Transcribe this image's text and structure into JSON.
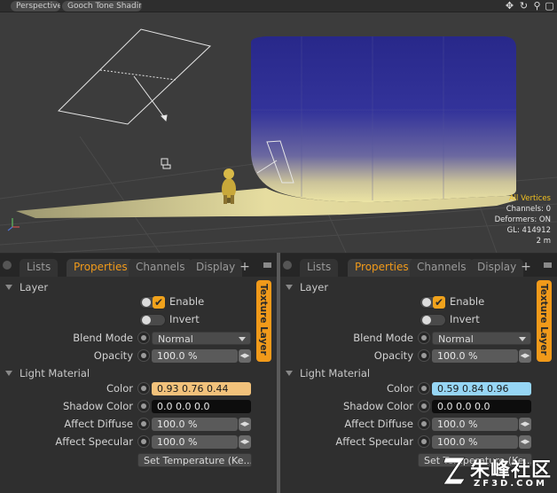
{
  "viewport": {
    "tabs": [
      "Perspective",
      "Gooch Tone Shadin..."
    ],
    "controls": [
      {
        "name": "move-view-icon",
        "glyph": "✥"
      },
      {
        "name": "refresh-icon",
        "glyph": "↻"
      },
      {
        "name": "search-icon",
        "glyph": "⚲"
      },
      {
        "name": "maximize-icon",
        "glyph": "▢"
      }
    ],
    "info": {
      "selection": "All Vertices",
      "channels": "Channels: 0",
      "deformers": "Deformers: ON",
      "gl": "GL: 414912",
      "scale": "2 m"
    }
  },
  "panels": [
    {
      "tabs": [
        "Lists",
        "Properties",
        "Channels",
        "Display"
      ],
      "active_tab": "Properties",
      "add_tab": "+",
      "side_tab": "Texture Layer",
      "layer_section": "Layer",
      "enable_label": "Enable",
      "enable_checked": true,
      "invert_label": "Invert",
      "blend_mode_label": "Blend Mode",
      "blend_mode_value": "Normal",
      "opacity_label": "Opacity",
      "opacity_value": "100.0 %",
      "light_section": "Light Material",
      "color_label": "Color",
      "color_value": "0.93  0.76  0.44",
      "color_swatch": "#f2c27b",
      "shadow_label": "Shadow Color",
      "shadow_value": "0.0    0.0    0.0",
      "diffuse_label": "Affect Diffuse",
      "diffuse_value": "100.0 %",
      "specular_label": "Affect Specular",
      "specular_value": "100.0 %",
      "temperature_button": "Set Temperature (Ke..."
    },
    {
      "tabs": [
        "Lists",
        "Properties",
        "Channels",
        "Display"
      ],
      "active_tab": "Properties",
      "add_tab": "+",
      "side_tab": "Texture Layer",
      "layer_section": "Layer",
      "enable_label": "Enable",
      "enable_checked": true,
      "invert_label": "Invert",
      "blend_mode_label": "Blend Mode",
      "blend_mode_value": "Normal",
      "opacity_label": "Opacity",
      "opacity_value": "100.0 %",
      "light_section": "Light Material",
      "color_label": "Color",
      "color_value": "0.59  0.84  0.96",
      "color_swatch": "#96d6f5",
      "shadow_label": "Shadow Color",
      "shadow_value": "0.0    0.0    0.0",
      "diffuse_label": "Affect Diffuse",
      "diffuse_value": "100.0 %",
      "specular_label": "Affect Specular",
      "specular_value": "100.0 %",
      "temperature_button": "Set Temperature (Ke..."
    }
  ],
  "watermark": {
    "title": "朱峰社区",
    "subtitle": "ZF3D.COM"
  },
  "colors": {
    "accent": "#f19a1a",
    "viewport_bg": "#3c3c3c",
    "backdrop_top": "#2a2a8c",
    "backdrop_bottom": "#e6dfa2"
  }
}
